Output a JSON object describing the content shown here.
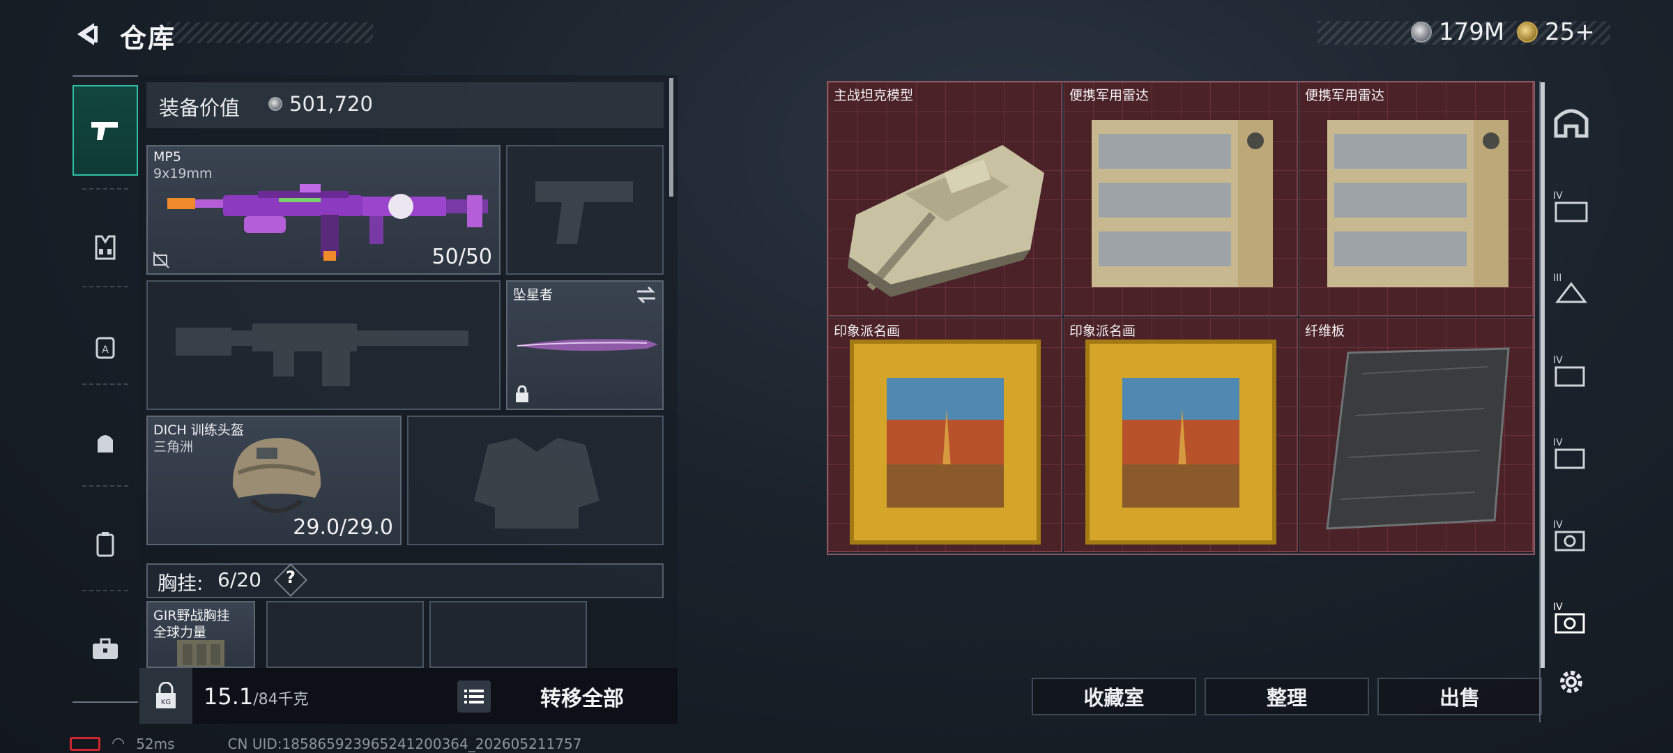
{
  "header": {
    "title": "仓库",
    "currencies": [
      {
        "icon": "silver-coin-icon",
        "value": "179M"
      },
      {
        "icon": "gold-coin-icon",
        "value": "25+"
      }
    ]
  },
  "left_rail": {
    "items": [
      {
        "icon": "pistol-icon",
        "active": true
      },
      {
        "icon": "vest-icon",
        "active": false
      },
      {
        "icon": "backpack-icon",
        "active": false
      },
      {
        "icon": "helmet-bag-icon",
        "active": false
      },
      {
        "icon": "clipboard-icon",
        "active": false
      },
      {
        "icon": "toolbox-icon",
        "active": false
      }
    ]
  },
  "equipment": {
    "value_label": "装备价值",
    "value": "501,720",
    "primary_weapon": {
      "name": "MP5",
      "ammo": "9x19mm",
      "durability": "50/50"
    },
    "melee": {
      "name": "坠星者"
    },
    "helmet": {
      "name": "DICH 训练头盔",
      "sub": "三角洲",
      "durability": "29.0/29.0"
    },
    "vest": {
      "label": "胸挂:",
      "count": "6/20",
      "help": "?"
    },
    "vest_item": {
      "name": "GIR野战胸挂",
      "sub": "全球力量"
    }
  },
  "bottom_left": {
    "weight": "15.1",
    "weight_capacity": "/84千克",
    "transfer_all": "转移全部"
  },
  "container": {
    "items": [
      {
        "name": "主战坦克模型",
        "icon": "tank-model-icon"
      },
      {
        "name": "便携军用雷达",
        "icon": "radar-icon"
      },
      {
        "name": "便携军用雷达",
        "icon": "radar-icon"
      },
      {
        "name": "印象派名画",
        "icon": "painting-icon"
      },
      {
        "name": "印象派名画",
        "icon": "painting-icon"
      },
      {
        "name": "纤维板",
        "icon": "fiberboard-icon"
      }
    ]
  },
  "actions": {
    "collection": "收藏室",
    "organize": "整理",
    "sell": "出售"
  },
  "right_rail": {
    "items": [
      "safe-icon",
      "container-4-icon",
      "container-3-icon",
      "container-4b-icon",
      "container-4c-icon",
      "container-4d-icon",
      "container-4e-icon"
    ],
    "settings": "gear-icon"
  },
  "status": {
    "ping": "52ms",
    "uid": "CN UID:18586592396524120036​4_202605211757"
  }
}
